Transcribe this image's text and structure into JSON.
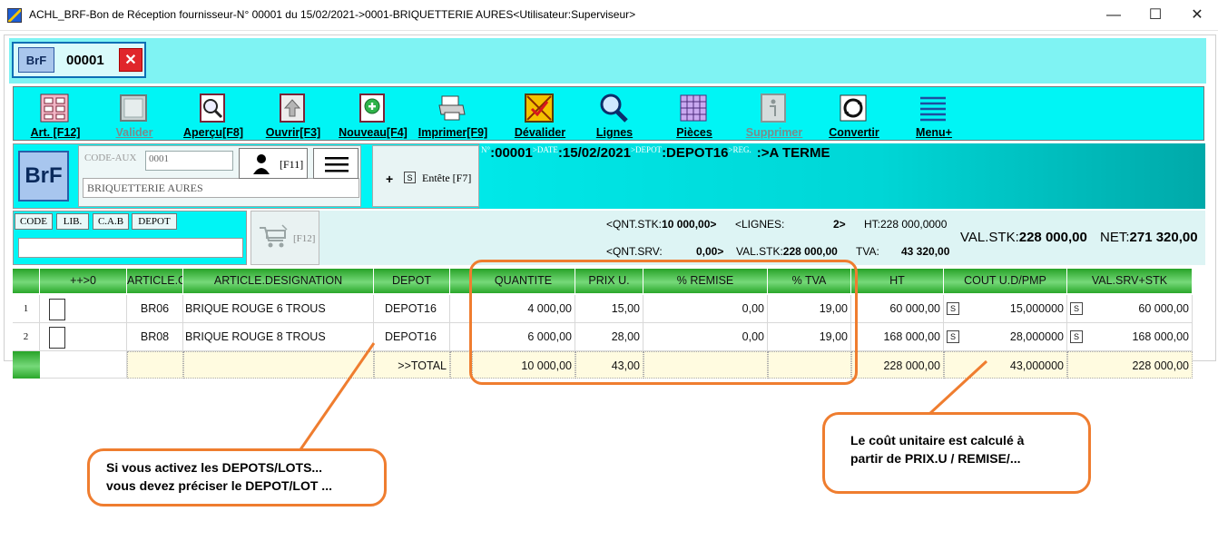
{
  "window": {
    "title": "ACHL_BRF-Bon de Réception fournisseur-N° 00001 du 15/02/2021->0001-BRIQUETTERIE AURES<Utilisateur:Superviseur>",
    "minimize": "—",
    "maximize": "☐",
    "close": "✕"
  },
  "doc_tab": {
    "code": "BrF",
    "number": "00001",
    "close": "✕"
  },
  "toolbar": {
    "items": [
      {
        "label": "Art. [F12]",
        "icon": "articles-icon",
        "enabled": true
      },
      {
        "label": "Valider",
        "icon": "validate-icon",
        "enabled": false
      },
      {
        "label": "Aperçu[F8]",
        "icon": "preview-icon",
        "enabled": true
      },
      {
        "label": "Ouvrir[F3]",
        "icon": "open-icon",
        "enabled": true
      },
      {
        "label": "Nouveau[F4]",
        "icon": "new-icon",
        "enabled": true
      },
      {
        "label": "Imprimer[F9]",
        "icon": "print-icon",
        "enabled": true
      },
      {
        "label": "Dévalider",
        "icon": "unvalidate-icon",
        "enabled": true
      },
      {
        "label": "Lignes",
        "icon": "lines-search-icon",
        "enabled": true
      },
      {
        "label": "Pièces",
        "icon": "pieces-icon",
        "enabled": true
      },
      {
        "label": "Supprimer",
        "icon": "delete-icon",
        "enabled": false
      },
      {
        "label": "Convertir",
        "icon": "convert-icon",
        "enabled": true
      },
      {
        "label": "Menu+",
        "icon": "menu-icon",
        "enabled": true
      }
    ]
  },
  "header": {
    "logo": "BrF",
    "aux_label": "CODE-AUX",
    "aux_code": "0001",
    "aux_name": "BRIQUETTERIE AURES",
    "user_key": "[F11]",
    "entete_s": "S",
    "entete_label": "Entête [F7]",
    "info": {
      "num_label": "N°",
      "num": ":00001",
      "date_label": ">DATE",
      "date": ":15/02/2021",
      "depot_label": ">DEPOT",
      "depot": ":DEPOT16",
      "reg_label": ">REG.",
      "reg": ":>A TERME"
    }
  },
  "search": {
    "tabs": [
      "CODE",
      "LIB.",
      "C.A.B",
      "DEPOT"
    ],
    "input_value": "",
    "cart_key": "[F12]"
  },
  "stats": {
    "qnt_stk_label": "<QNT.STK:",
    "qnt_stk": "10 000,00>",
    "lignes_label": "<LIGNES:",
    "lignes": "2>",
    "ht_label": "HT:",
    "ht": "228 000,0000",
    "qnt_srv_label": "<QNT.SRV:",
    "qnt_srv": "0,00>",
    "val_stk_small_label": "VAL.STK:",
    "val_stk_small": "228 000,00",
    "tva_label": "TVA:",
    "tva": "43 320,00",
    "val_stk_label": "VAL.STK:",
    "val_stk": "228 000,00",
    "net_label": "NET:",
    "net": "271 320,00"
  },
  "grid": {
    "columns": [
      "",
      "++>0",
      "ARTICLE.C",
      "ARTICLE.DESIGNATION",
      "DEPOT",
      "",
      "QUANTITE",
      "PRIX U.",
      "% REMISE",
      "% TVA",
      "HT",
      "COUT U.D/PMP",
      "VAL.SRV+STK"
    ],
    "rows": [
      {
        "n": "1",
        "code": "BR06",
        "designation": "BRIQUE ROUGE 6 TROUS",
        "depot": "DEPOT16",
        "quantite": "4 000,00",
        "prix": "15,00",
        "remise": "0,00",
        "tva": "19,00",
        "ht": "60 000,00",
        "cout": "15,000000",
        "val": "60 000,00"
      },
      {
        "n": "2",
        "code": "BR08",
        "designation": "BRIQUE ROUGE 8 TROUS",
        "depot": "DEPOT16",
        "quantite": "6 000,00",
        "prix": "28,00",
        "remise": "0,00",
        "tva": "19,00",
        "ht": "168 000,00",
        "cout": "28,000000",
        "val": "168 000,00"
      }
    ],
    "total": {
      "label": ">>TOTAL",
      "quantite": "10 000,00",
      "prix": "43,00",
      "ht": "228 000,00",
      "cout": "43,000000",
      "val": "228 000,00"
    },
    "s_marker": "S"
  },
  "annotations": {
    "left_line1": "Si vous activez les DEPOTS/LOTS...",
    "left_line2": "vous devez préciser le DEPOT/LOT ...",
    "right_line1": "Le coût unitaire est calculé à",
    "right_line2": "partir de PRIX.U / REMISE/..."
  },
  "colors": {
    "cyan": "#00f5f5",
    "grid_header": "#3cb93c",
    "callout": "#ef7d2f",
    "total_row": "#fffbe0"
  }
}
